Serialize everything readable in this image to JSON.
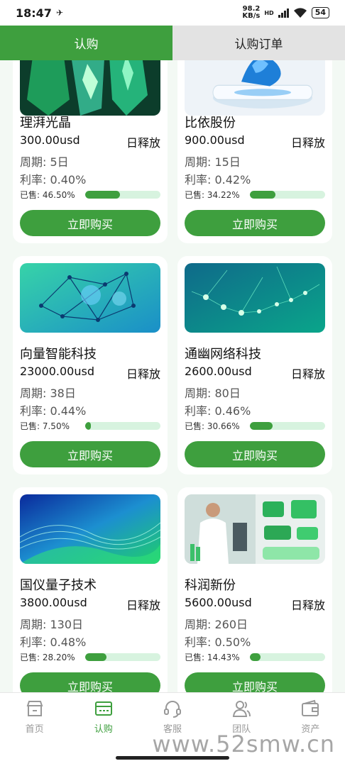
{
  "status_bar": {
    "time": "18:47",
    "net_speed_top": "98.2",
    "net_speed_bottom": "KB/s",
    "hd": "HD",
    "battery": "54"
  },
  "tabs": [
    {
      "label": "认购"
    },
    {
      "label": "认购订单"
    }
  ],
  "products": [
    {
      "name": "理湃光晶",
      "price": "300.00usd",
      "release": "日释放",
      "period": "周期: 5日",
      "rate": "利率: 0.40%",
      "sold": "已售: 46.50%",
      "sold_fraction": 0.465,
      "button": "立即购买",
      "image": "crystal-image"
    },
    {
      "name": "比依股份",
      "price": "900.00usd",
      "release": "日释放",
      "period": "周期: 15日",
      "rate": "利率: 0.42%",
      "sold": "已售: 34.22%",
      "sold_fraction": 0.3422,
      "button": "立即购买",
      "image": "device-image"
    },
    {
      "name": "向量智能科技",
      "price": "23000.00usd",
      "release": "日释放",
      "period": "周期: 38日",
      "rate": "利率: 0.44%",
      "sold": "已售: 7.50%",
      "sold_fraction": 0.075,
      "button": "立即购买",
      "image": "network-molecule-image"
    },
    {
      "name": "通幽网络科技",
      "price": "2600.00usd",
      "release": "日释放",
      "period": "周期: 80日",
      "rate": "利率: 0.46%",
      "sold": "已售: 30.66%",
      "sold_fraction": 0.3066,
      "button": "立即购买",
      "image": "network-lines-image"
    },
    {
      "name": "国仪量子技术",
      "price": "3800.00usd",
      "release": "日释放",
      "period": "周期: 130日",
      "rate": "利率: 0.48%",
      "sold": "已售: 28.20%",
      "sold_fraction": 0.282,
      "button": "立即购买",
      "image": "wave-image"
    },
    {
      "name": "科润新份",
      "price": "5600.00usd",
      "release": "日释放",
      "period": "周期: 260日",
      "rate": "利率: 0.50%",
      "sold": "已售: 14.43%",
      "sold_fraction": 0.1443,
      "button": "立即购买",
      "image": "lab-image"
    }
  ],
  "bottom_nav": [
    {
      "label": "首页",
      "icon": "store-icon"
    },
    {
      "label": "认购",
      "icon": "card-icon"
    },
    {
      "label": "客服",
      "icon": "headset-icon"
    },
    {
      "label": "团队",
      "icon": "team-icon"
    },
    {
      "label": "资产",
      "icon": "wallet-icon"
    }
  ],
  "watermark": "www.52smw.cn",
  "colors": {
    "accent": "#3e9f3e",
    "progress_track": "#d7f3df",
    "page_bg": "#f3f9f4"
  }
}
